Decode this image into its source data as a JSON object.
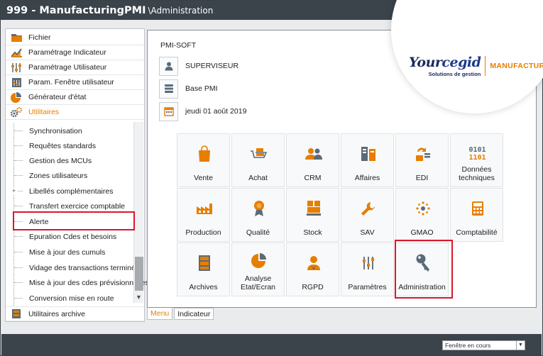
{
  "window": {
    "title_main": "999 - ManufacturingPMI",
    "title_sub": "\\Administration"
  },
  "sidebar": {
    "items": [
      {
        "label": "Fichier",
        "icon": "folder-icon"
      },
      {
        "label": "Paramétrage Indicateur",
        "icon": "chart-icon"
      },
      {
        "label": "Paramétrage Utilisateur",
        "icon": "sliders-icon"
      },
      {
        "label": "Param. Fenêtre utilisateur",
        "icon": "window-settings-icon"
      },
      {
        "label": "Générateur d'état",
        "icon": "pie-chart-icon"
      },
      {
        "label": "Utilitaires",
        "icon": "gears-icon"
      }
    ],
    "subitems": [
      {
        "label": "Synchronisation"
      },
      {
        "label": "Requêtes standards"
      },
      {
        "label": "Gestion des MCUs"
      },
      {
        "label": "Zones utilisateurs"
      },
      {
        "label": "Libellés complémentaires",
        "expand": "+"
      },
      {
        "label": "Transfert exercice comptable"
      },
      {
        "label": "Alerte"
      },
      {
        "label": "Epuration Cdes et besoins"
      },
      {
        "label": "Mise à jour des cumuls"
      },
      {
        "label": "Vidage des transactions terminées"
      },
      {
        "label": "Mise à jour des cdes prévisionnelles"
      },
      {
        "label": "Conversion mise en route"
      }
    ],
    "bottom_item": {
      "label": "Utilitaires archive",
      "icon": "archive-icon"
    }
  },
  "content": {
    "company": "PMI-SOFT",
    "user": "SUPERVISEUR",
    "database": "Base PMI",
    "date": "jeudi 01 août 2019"
  },
  "logo": {
    "brand_a": "Your",
    "brand_b": "cegid",
    "tagline": "Solutions de gestion",
    "product": "MANUFACTURING"
  },
  "tiles": [
    {
      "label": "Vente",
      "icon": "shopping-bag-icon"
    },
    {
      "label": "Achat",
      "icon": "cart-icon"
    },
    {
      "label": "CRM",
      "icon": "users-icon"
    },
    {
      "label": "Affaires",
      "icon": "files-icon"
    },
    {
      "label": "EDI",
      "icon": "exchange-icon"
    },
    {
      "label": "Données techniques",
      "icon": "binary-icon",
      "icon_text_1": "0101",
      "icon_text_2": "1101"
    },
    {
      "label": "Production",
      "icon": "factory-icon"
    },
    {
      "label": "Qualité",
      "icon": "award-icon"
    },
    {
      "label": "Stock",
      "icon": "pallet-icon"
    },
    {
      "label": "SAV",
      "icon": "wrench-icon"
    },
    {
      "label": "GMAO",
      "icon": "maintenance-icon"
    },
    {
      "label": "Comptabilité",
      "icon": "calculator-icon"
    },
    {
      "label": "Archives",
      "icon": "cabinet-icon"
    },
    {
      "label": "Analyse Etat/Ecran",
      "icon": "pie-chart-icon"
    },
    {
      "label": "RGPD",
      "icon": "user-shield-icon"
    },
    {
      "label": "Paramètres",
      "icon": "sliders-icon"
    },
    {
      "label": "Administration",
      "icon": "key-icon"
    }
  ],
  "tabs": [
    {
      "label": "Menu",
      "active": true
    },
    {
      "label": "Indicateur",
      "active": false
    }
  ],
  "statusbar": {
    "window_select": "Fenêtre en cours"
  },
  "colors": {
    "accent": "#e67e00",
    "titlebar": "#3b434b",
    "highlight": "#d8182a",
    "icon_gray": "#5b6a78"
  }
}
